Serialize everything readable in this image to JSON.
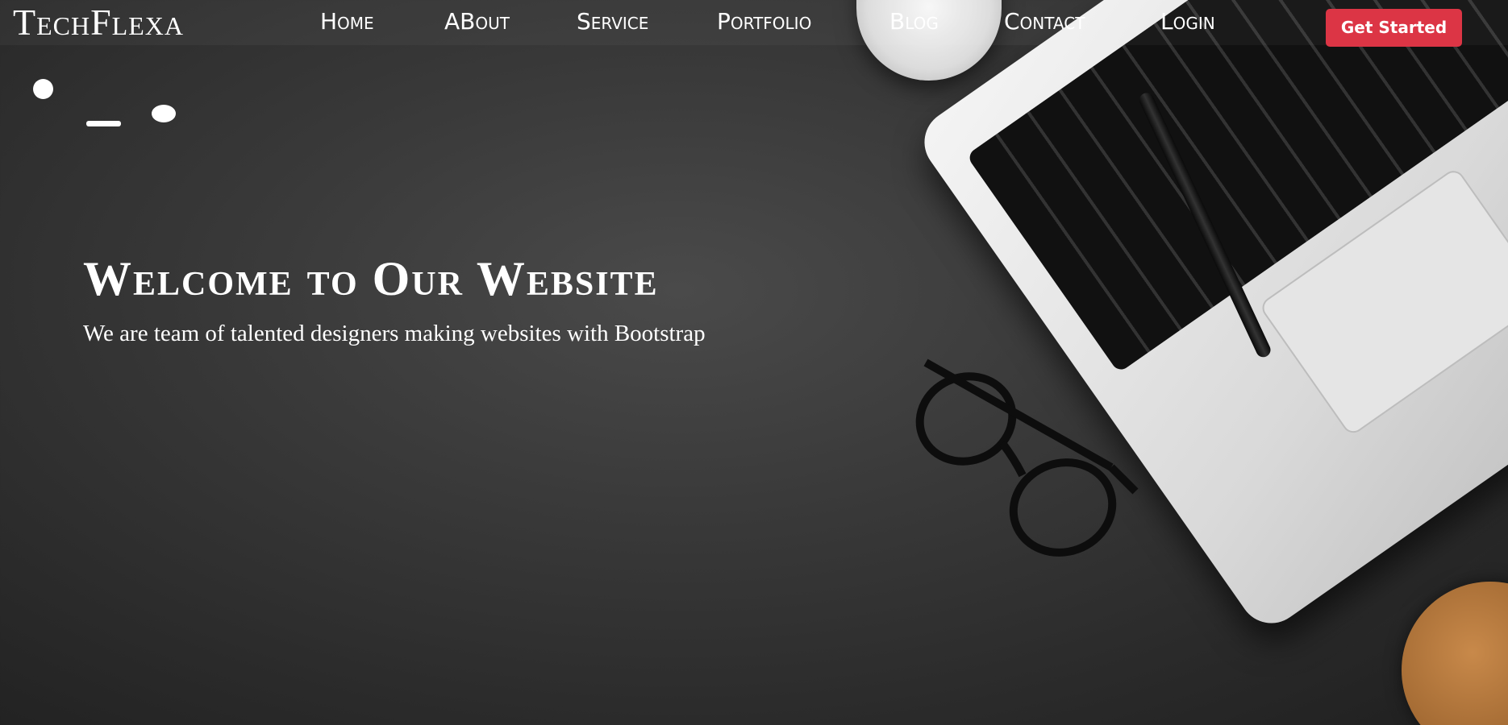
{
  "brand": {
    "name": "TechFlexa"
  },
  "nav": {
    "items": [
      {
        "label": "Home"
      },
      {
        "label": "ABout"
      },
      {
        "label": "Service"
      },
      {
        "label": "Portfolio"
      },
      {
        "label": "Blog"
      },
      {
        "label": "Contact"
      },
      {
        "label": "Login"
      }
    ],
    "cta_label": "Get Started"
  },
  "hero": {
    "title": "Welcome to Our Website",
    "subtitle": "We are team of talented designers making websites with Bootstrap"
  },
  "colors": {
    "accent": "#dc3545",
    "background": "#333333",
    "text": "#ffffff"
  },
  "icons": [
    "mug-icon",
    "laptop-icon",
    "pen-icon",
    "glasses-icon",
    "cork-coaster-icon"
  ]
}
